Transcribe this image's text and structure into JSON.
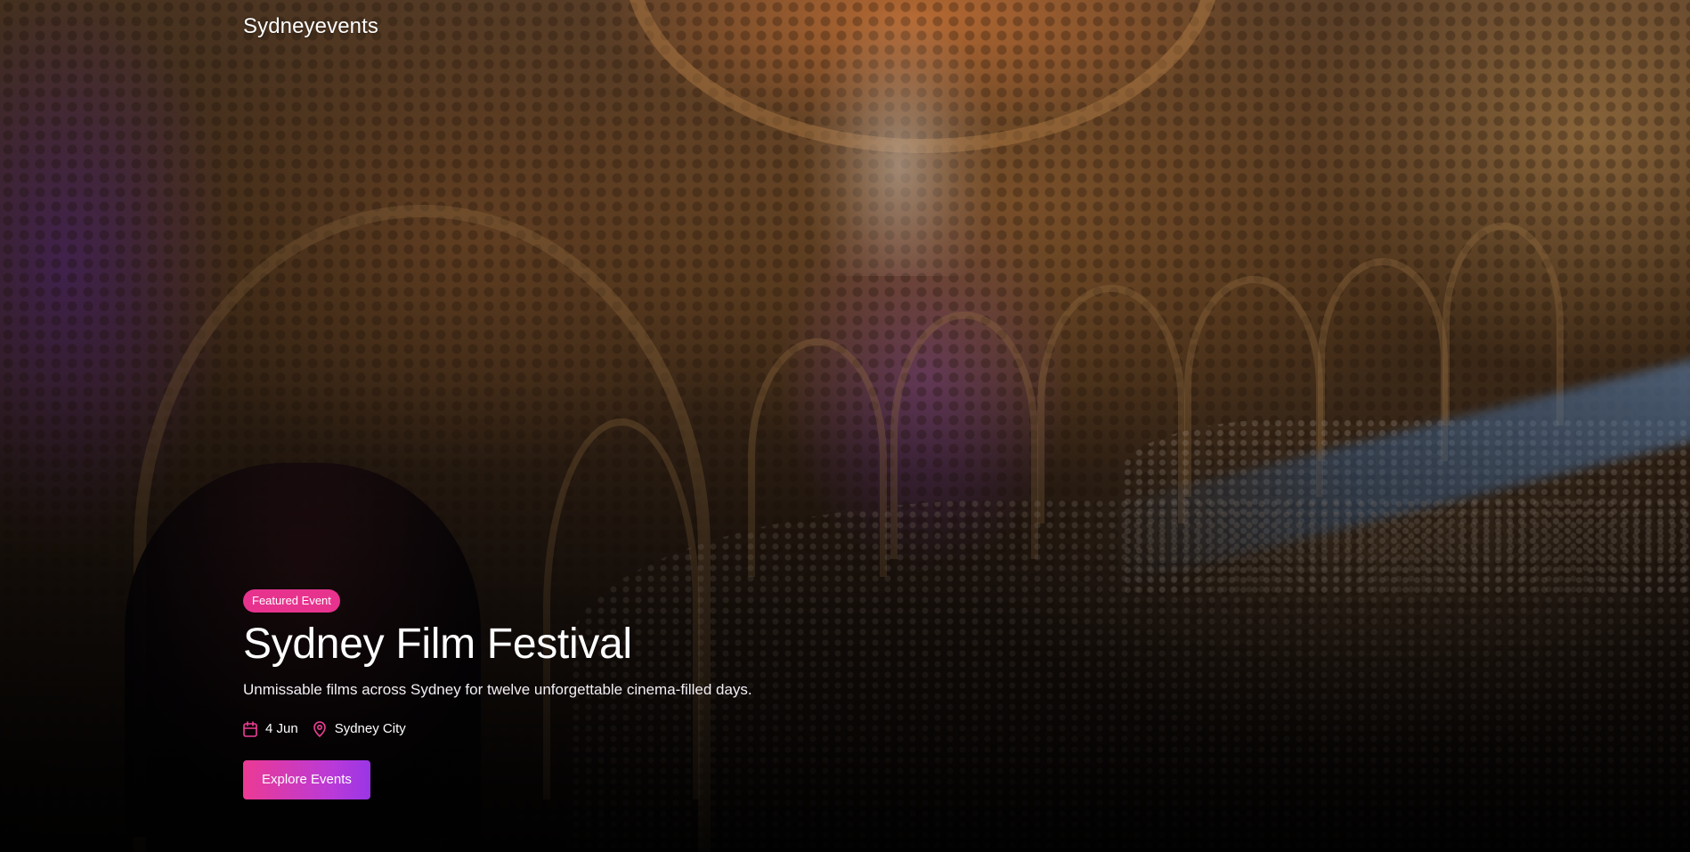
{
  "header": {
    "brand": "Sydneyevents"
  },
  "hero": {
    "badge": "Featured Event",
    "title": "Sydney Film Festival",
    "subtitle": "Unmissable films across Sydney for twelve unforgettable cinema-filled days.",
    "date": "4 Jun",
    "location": "Sydney City",
    "cta_label": "Explore Events",
    "icons": {
      "date": "calendar-icon",
      "location": "map-pin-icon"
    }
  },
  "colors": {
    "accent_pink": "#e7338e",
    "accent_purple": "#9a36e6",
    "icon_pink": "#ee3f95"
  }
}
